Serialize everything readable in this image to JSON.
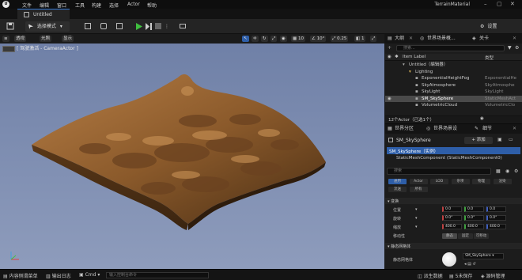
{
  "menu": {
    "items": [
      "文件",
      "编辑",
      "窗口",
      "工具",
      "构建",
      "选择",
      "Actor",
      "帮助"
    ],
    "project_name": "TerrainMaterial"
  },
  "document_tab": {
    "label": "Untitled"
  },
  "toolbar": {
    "mode_label": "选择模式",
    "settings_label": "设置"
  },
  "viewport": {
    "perspective_label": "透视",
    "lit_label": "光照",
    "show_label": "显示",
    "camera_label": "[ 驾驶激活 - CameraActor ]",
    "grid_value": "10",
    "angle_value": "10°",
    "scale_value": "0.25",
    "camera_speed": "1"
  },
  "outliner": {
    "tabs": [
      "大纲",
      "世界场景概...",
      "关卡"
    ],
    "search_placeholder": "搜索...",
    "col_label": "Item Label",
    "col_type": "类型",
    "rows": [
      {
        "name": "Untitled（编辑器）",
        "type": "",
        "indent": 0,
        "selected": false
      },
      {
        "name": "Lighting",
        "type": "",
        "indent": 1,
        "selected": false
      },
      {
        "name": "ExponentialHeightFog",
        "type": "ExponentialHe",
        "indent": 2,
        "selected": false
      },
      {
        "name": "SkyAtmosphere",
        "type": "SkyAtmosphe",
        "indent": 2,
        "selected": false
      },
      {
        "name": "SkyLight",
        "type": "SkyLight",
        "indent": 2,
        "selected": false
      },
      {
        "name": "SM_SkySphere",
        "type": "StaticMeshAct",
        "indent": 2,
        "selected": true
      },
      {
        "name": "VolumetricCloud",
        "type": "VolumetricClo",
        "indent": 2,
        "selected": false
      }
    ],
    "footer": "12个Actor（已选1个）"
  },
  "details": {
    "tabs": [
      "世界分区",
      "世界场景设",
      "细节"
    ],
    "actor_name": "SM_SkySphere",
    "add_label": "+ 添加",
    "component_root": "SM_SkySphere（实例）",
    "component_child": "StaticMeshComponent (StaticMeshComponent0)",
    "search_placeholder": "搜索",
    "categories_row1": [
      "通用",
      "Actor",
      "LOD",
      "杂项",
      "物理",
      "渲染"
    ],
    "categories_row2": [
      "流送",
      "所有"
    ],
    "section_transform": "变换",
    "transform": [
      {
        "label": "位置",
        "values": [
          "0.0",
          "0.0",
          "0.0"
        ]
      },
      {
        "label": "旋转",
        "values": [
          "0.0°",
          "0.0°",
          "0.0°"
        ]
      },
      {
        "label": "缩放",
        "values": [
          "400.0",
          "400.0",
          "400.0"
        ]
      }
    ],
    "mobility_label": "移动性",
    "mobility_options": [
      "静态",
      "固定",
      "可移动"
    ],
    "section_mesh": "静态网格体",
    "mesh_label": "静态网格体",
    "mesh_value": "SM_SkySphere"
  },
  "statusbar": {
    "content_drawer": "内容侧滑菜单",
    "output_log": "输出日志",
    "cmd": "Cmd",
    "cmd_placeholder": "输入控制台命令",
    "derived_data": "派生数据",
    "unsaved": "5未保存",
    "source_control": "源码管理"
  }
}
